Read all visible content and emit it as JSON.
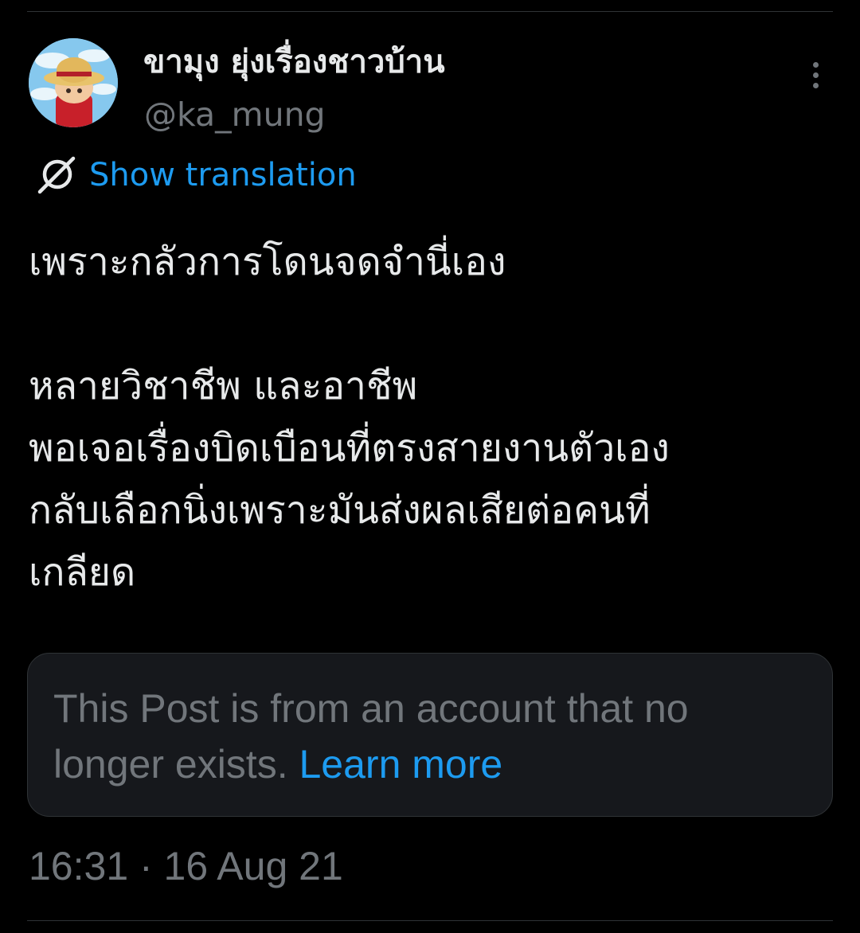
{
  "post": {
    "author": {
      "display_name": "ขามุง ยุ่งเรื่องชาวบ้าน",
      "handle": "@ka_mung",
      "avatar_icon": "avatar-straw-hat-character"
    },
    "more_icon": "more-vertical-icon",
    "translation": {
      "icon": "translate-icon",
      "label": "Show translation"
    },
    "body_lines": [
      "เพราะกลัวการโดนจดจำนี่เอง",
      "",
      "หลายวิชาชีพ และอาชีพ",
      "พอเจอเรื่องบิดเบือนที่ตรงสายงานตัวเอง",
      "กลับเลือกนิ่งเพราะมันส่งผลเสียต่อคนที่",
      "เกลียด"
    ],
    "notice": {
      "text": "This Post is from an account that no longer exists.",
      "link_label": "Learn more"
    },
    "timestamp": "16:31 · 16 Aug 21"
  },
  "colors": {
    "background": "#000000",
    "primary_text": "#e7e9ea",
    "secondary_text": "#71767b",
    "accent": "#1d9bf0",
    "card_background": "#16181c",
    "border": "#2f3336"
  }
}
